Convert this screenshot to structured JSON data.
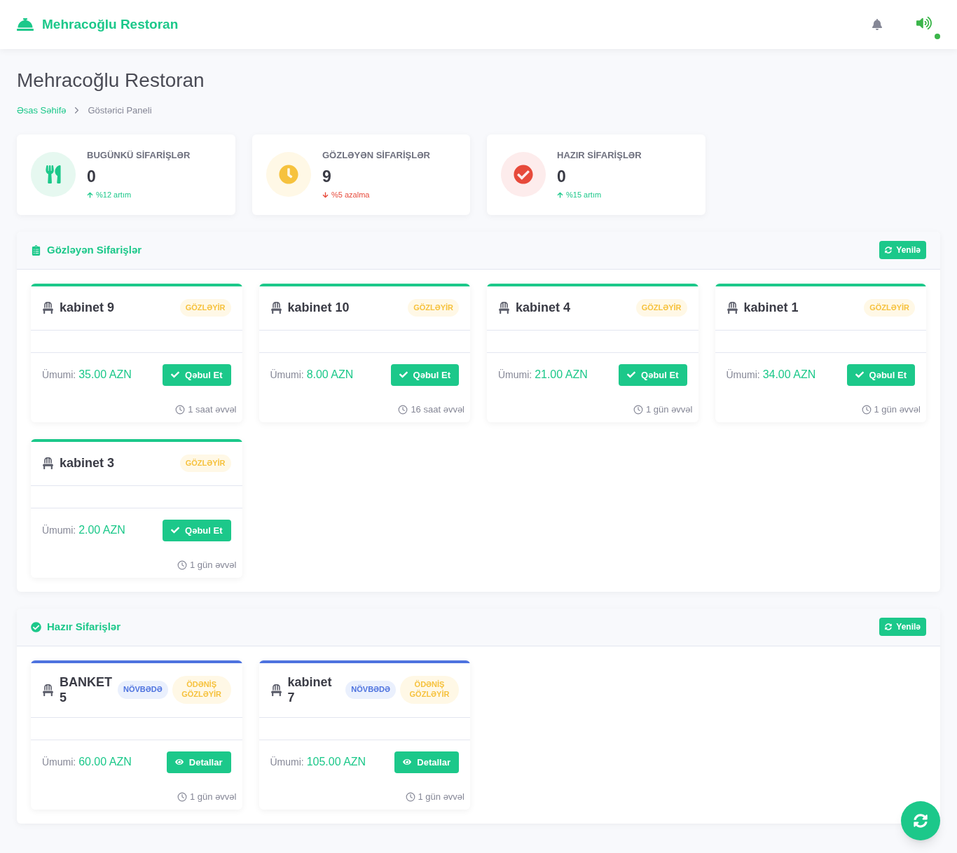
{
  "header": {
    "brand": "Mehracoğlu Restoran"
  },
  "page": {
    "title": "Mehracoğlu Restoran",
    "breadcrumb": [
      {
        "label": "Əsas Səhifə",
        "link": true
      },
      {
        "label": "Göstərici Paneli",
        "link": false
      }
    ]
  },
  "stats": [
    {
      "kind": "orders",
      "label": "BUGÜNKÜ SİFARİŞLƏR",
      "value": "0",
      "increase": true,
      "change": "%12 artım"
    },
    {
      "kind": "pending",
      "label": "GÖZLƏYƏN SİFARİŞLƏR",
      "value": "9",
      "increase": false,
      "change": "%5 azalma"
    },
    {
      "kind": "ready",
      "label": "HAZIR SİFARİŞLƏR",
      "value": "0",
      "increase": true,
      "change": "%15 artım"
    }
  ],
  "sections": [
    {
      "kind": "pending",
      "title": "Gözləyən Sifarişlər",
      "refresh": "Yenilə",
      "orders": [
        {
          "table": "kabinet 9",
          "badges": [
            {
              "kind": "waiting",
              "label": "GÖZLƏYİR"
            }
          ],
          "total_label": "Ümumi:",
          "total": "35.00 AZN",
          "action": {
            "kind": "accept",
            "label": "Qəbul Et"
          },
          "time": "1 saat əvvəl"
        },
        {
          "table": "kabinet 10",
          "badges": [
            {
              "kind": "waiting",
              "label": "GÖZLƏYİR"
            }
          ],
          "total_label": "Ümumi:",
          "total": "8.00 AZN",
          "action": {
            "kind": "accept",
            "label": "Qəbul Et"
          },
          "time": "16 saat əvvəl"
        },
        {
          "table": "kabinet 4",
          "badges": [
            {
              "kind": "waiting",
              "label": "GÖZLƏYİR"
            }
          ],
          "total_label": "Ümumi:",
          "total": "21.00 AZN",
          "action": {
            "kind": "accept",
            "label": "Qəbul Et"
          },
          "time": "1 gün əvvəl"
        },
        {
          "table": "kabinet 1",
          "badges": [
            {
              "kind": "waiting",
              "label": "GÖZLƏYİR"
            }
          ],
          "total_label": "Ümumi:",
          "total": "34.00 AZN",
          "action": {
            "kind": "accept",
            "label": "Qəbul Et"
          },
          "time": "1 gün əvvəl"
        },
        {
          "table": "kabinet 3",
          "badges": [
            {
              "kind": "waiting",
              "label": "GÖZLƏYİR"
            }
          ],
          "total_label": "Ümumi:",
          "total": "2.00 AZN",
          "action": {
            "kind": "accept",
            "label": "Qəbul Et"
          },
          "time": "1 gün əvvəl"
        }
      ]
    },
    {
      "kind": "ready",
      "title": "Hazır Sifarişlər",
      "refresh": "Yenilə",
      "orders": [
        {
          "table": "BANKET 5",
          "badges": [
            {
              "kind": "queued",
              "label": "NÖVBƏDƏ"
            },
            {
              "kind": "waiting",
              "label": "ÖDƏNİŞ GÖZLƏYİR"
            }
          ],
          "total_label": "Ümumi:",
          "total": "60.00 AZN",
          "action": {
            "kind": "details",
            "label": "Detallar"
          },
          "time": "1 gün əvvəl"
        },
        {
          "table": "kabinet 7",
          "badges": [
            {
              "kind": "queued",
              "label": "NÖVBƏDƏ"
            },
            {
              "kind": "waiting",
              "label": "ÖDƏNİŞ GÖZLƏYİR"
            }
          ],
          "total_label": "Ümumi:",
          "total": "105.00 AZN",
          "action": {
            "kind": "details",
            "label": "Detallar"
          },
          "time": "1 gün əvvəl"
        }
      ]
    }
  ]
}
